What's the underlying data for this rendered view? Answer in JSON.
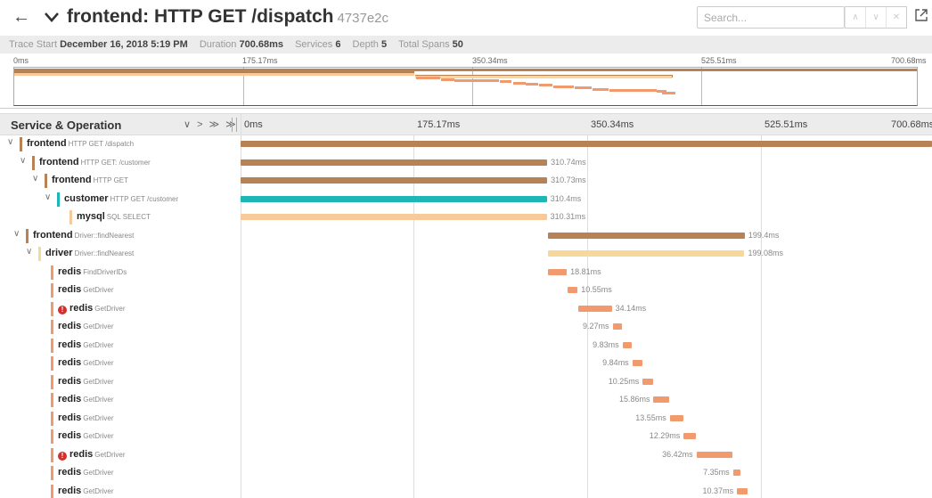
{
  "header": {
    "back_icon": "arrow-left-icon",
    "collapse_icon": "chevron-down-icon",
    "title": "frontend: HTTP GET /dispatch",
    "trace_id": "4737e2c",
    "search_placeholder": "Search...",
    "external_icon": "external-link-icon"
  },
  "meta": {
    "trace_start_label": "Trace Start",
    "trace_start": "December 16, 2018 5:19 PM",
    "duration_label": "Duration",
    "duration": "700.68ms",
    "services_label": "Services",
    "services": "6",
    "depth_label": "Depth",
    "depth": "5",
    "total_spans_label": "Total Spans",
    "total_spans": "50"
  },
  "minimap": {
    "ticks": [
      "0ms",
      "175.17ms",
      "350.34ms",
      "525.51ms",
      "700.68ms"
    ]
  },
  "timeline": {
    "column_title": "Service & Operation",
    "controls": "∨ > ≫ ≫",
    "ticks": [
      "0ms",
      "175.17ms",
      "350.34ms",
      "525.51ms",
      "700.68ms"
    ]
  },
  "colors": {
    "frontend": "#b78255",
    "customer": "#1fb6b8",
    "mysql": "#f8c99a",
    "driver": "#f6d79c",
    "redis": "#f19a6e",
    "error": "#d0312d"
  },
  "spans": [
    {
      "service": "frontend",
      "operation": "HTTP GET /dispatch",
      "depth": 0,
      "caret": true,
      "start": 0,
      "duration": 700.68,
      "label": "",
      "error": false
    },
    {
      "service": "frontend",
      "operation": "HTTP GET: /customer",
      "depth": 1,
      "caret": true,
      "start": 0,
      "duration": 310.74,
      "label": "310.74ms",
      "error": false
    },
    {
      "service": "frontend",
      "operation": "HTTP GET",
      "depth": 2,
      "caret": true,
      "start": 0,
      "duration": 310.73,
      "label": "310.73ms",
      "error": false
    },
    {
      "service": "customer",
      "operation": "HTTP GET /customer",
      "depth": 3,
      "caret": true,
      "start": 0,
      "duration": 310.4,
      "label": "310.4ms",
      "error": false
    },
    {
      "service": "mysql",
      "operation": "SQL SELECT",
      "depth": 4,
      "caret": false,
      "start": 0,
      "duration": 310.31,
      "label": "310.31ms",
      "error": false
    },
    {
      "service": "frontend",
      "operation": "Driver::findNearest",
      "depth": 0.5,
      "caret": true,
      "start": 311.5,
      "duration": 199.4,
      "label": "199.4ms",
      "error": false
    },
    {
      "service": "driver",
      "operation": "Driver::findNearest",
      "depth": 1.5,
      "caret": true,
      "start": 311.5,
      "duration": 199.08,
      "label": "199.08ms",
      "error": false
    },
    {
      "service": "redis",
      "operation": "FindDriverIDs",
      "depth": 2.5,
      "caret": false,
      "start": 311.8,
      "duration": 18.81,
      "label": "18.81ms",
      "error": false
    },
    {
      "service": "redis",
      "operation": "GetDriver",
      "depth": 2.5,
      "caret": false,
      "start": 331,
      "duration": 10.55,
      "label": "10.55ms",
      "error": false
    },
    {
      "service": "redis",
      "operation": "GetDriver",
      "depth": 2.5,
      "caret": false,
      "start": 342,
      "duration": 34.14,
      "label": "34.14ms",
      "error": true
    },
    {
      "service": "redis",
      "operation": "GetDriver",
      "depth": 2.5,
      "caret": false,
      "start": 377,
      "duration": 9.27,
      "label": "9.27ms",
      "error": false
    },
    {
      "service": "redis",
      "operation": "GetDriver",
      "depth": 2.5,
      "caret": false,
      "start": 387,
      "duration": 9.83,
      "label": "9.83ms",
      "error": false
    },
    {
      "service": "redis",
      "operation": "GetDriver",
      "depth": 2.5,
      "caret": false,
      "start": 397,
      "duration": 9.84,
      "label": "9.84ms",
      "error": false
    },
    {
      "service": "redis",
      "operation": "GetDriver",
      "depth": 2.5,
      "caret": false,
      "start": 407.5,
      "duration": 10.25,
      "label": "10.25ms",
      "error": false
    },
    {
      "service": "redis",
      "operation": "GetDriver",
      "depth": 2.5,
      "caret": false,
      "start": 418.5,
      "duration": 15.86,
      "label": "15.86ms",
      "error": false
    },
    {
      "service": "redis",
      "operation": "GetDriver",
      "depth": 2.5,
      "caret": false,
      "start": 435,
      "duration": 13.55,
      "label": "13.55ms",
      "error": false
    },
    {
      "service": "redis",
      "operation": "GetDriver",
      "depth": 2.5,
      "caret": false,
      "start": 449,
      "duration": 12.29,
      "label": "12.29ms",
      "error": false
    },
    {
      "service": "redis",
      "operation": "GetDriver",
      "depth": 2.5,
      "caret": false,
      "start": 462,
      "duration": 36.42,
      "label": "36.42ms",
      "error": true
    },
    {
      "service": "redis",
      "operation": "GetDriver",
      "depth": 2.5,
      "caret": false,
      "start": 499,
      "duration": 7.35,
      "label": "7.35ms",
      "error": false
    },
    {
      "service": "redis",
      "operation": "GetDriver",
      "depth": 2.5,
      "caret": false,
      "start": 503,
      "duration": 10.37,
      "label": "10.37ms",
      "error": false
    }
  ]
}
